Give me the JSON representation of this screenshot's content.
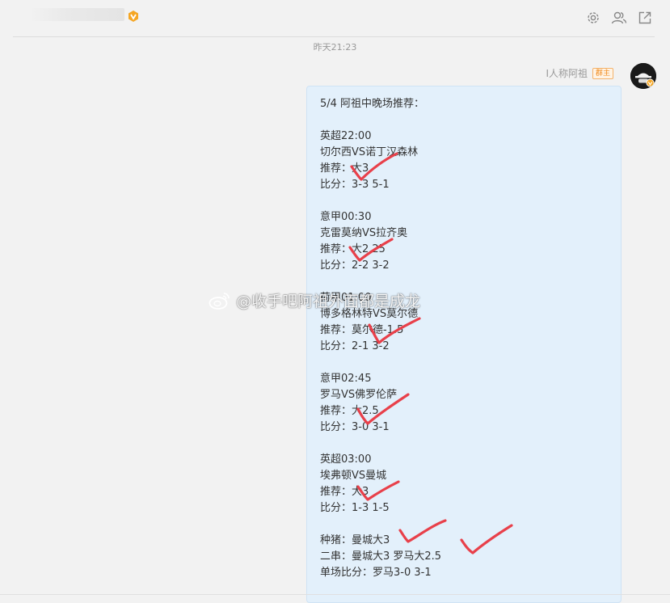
{
  "header": {
    "name_blurred": true,
    "badge_icon": "verified-orange-badge-icon",
    "actions": [
      {
        "icon": "gear-icon"
      },
      {
        "icon": "group-icon"
      },
      {
        "icon": "external-open-icon"
      }
    ]
  },
  "chat": {
    "timestamp": "昨天21:23",
    "message": {
      "sender_name": "I人称阿祖",
      "sender_tag": "群主",
      "lines": [
        "5/4 阿祖中晚场推荐：",
        "",
        "英超22:00",
        "切尔西VS诺丁汉森林",
        "推荐：大3",
        "比分：3-3 5-1",
        "",
        "意甲00:30",
        "克雷莫纳VS拉齐奥",
        "推荐：大2.25",
        "比分：2-2 3-2",
        "",
        "荷甲01:00",
        "博多格林特VS莫尔德",
        "推荐：莫尔德-1.5",
        "比分：2-1 3-2",
        "",
        "意甲02:45",
        "罗马VS佛罗伦萨",
        "推荐：大2.5",
        "比分：3-0 3-1",
        "",
        "英超03:00",
        "埃弗顿VS曼城",
        "推荐：大3",
        "比分：1-3 1-5",
        "",
        "种猪：曼城大3",
        "二串：曼城大3 罗马大2.5",
        "单场比分：罗马3-0 3-1"
      ]
    }
  },
  "watermark": {
    "text": "@收手吧阿祖外面都是成龙"
  },
  "colors": {
    "bubble_bg": "#e3f0fb",
    "check_red": "#e8404a",
    "tag_orange": "#f08a1c"
  }
}
